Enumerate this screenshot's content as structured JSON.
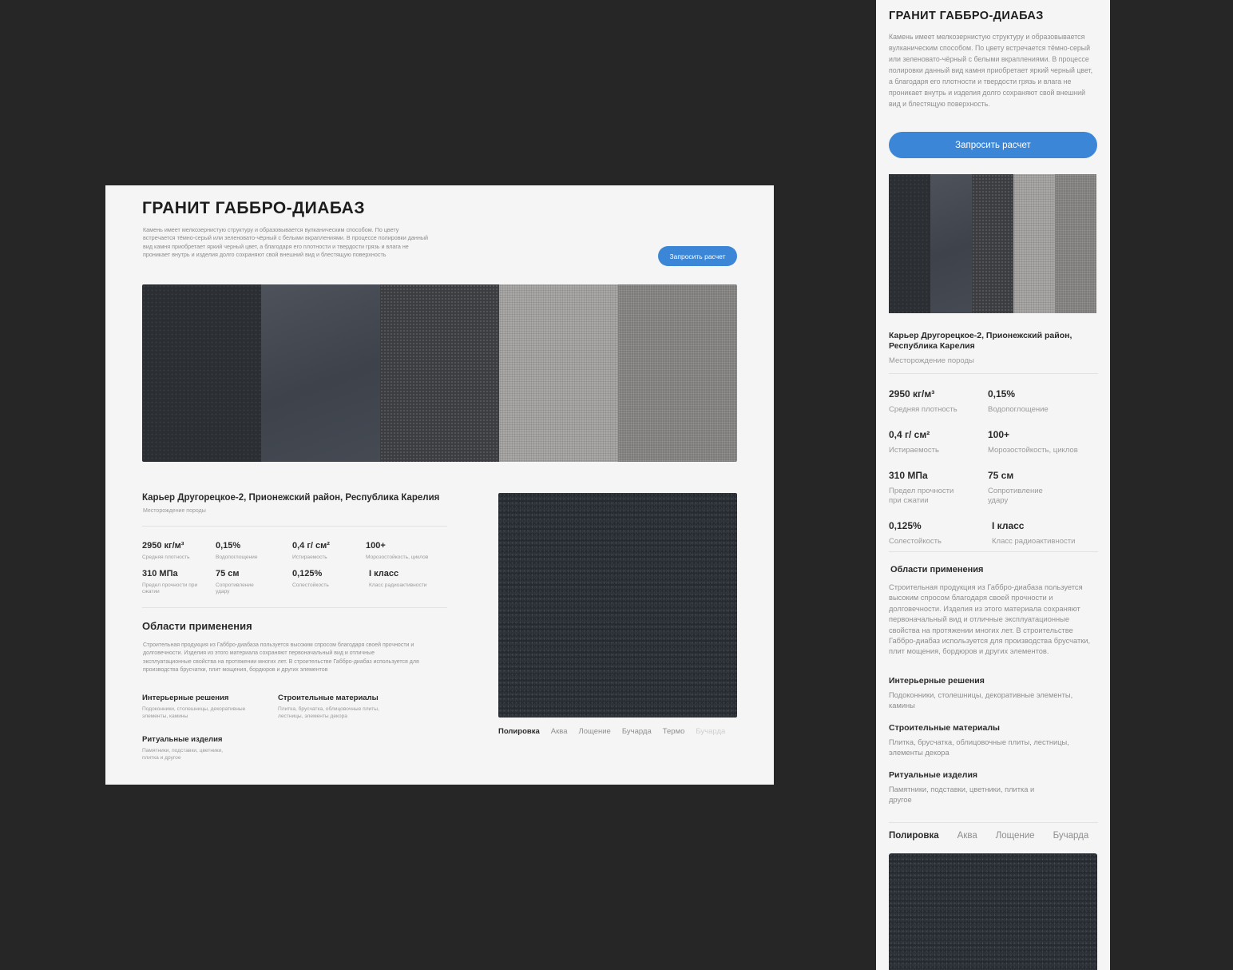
{
  "title": "ГРАНИТ ГАББРО-ДИАБАЗ",
  "desktop": {
    "description": "Камень имеет мелкозернистую структуру и образовывается вулканическим способом. По цвету встречается тёмно-серый или зеленовато-чёрный с белыми вкраплениями. В процессе полировки данный вид камня приобретает яркий черный цвет, а благодаря его плотности и твердости грязь и влага не проникает внутрь и изделия долго сохраняют свой внешний вид и блестящую поверхность",
    "area_text": "Строительная продукция из Габбро-диабаза пользуется высоким спросом благодаря своей прочности и долговечности. Изделия из этого материала сохраняют первоначальный вид и отличные эксплуатационные свойства на протяжении многих лет. В строительстве Габбро-диабаз используется для производства брусчатки, плит мощения, бордюров и других элементов",
    "quarry": "Карьер Другорецкое-2, Прионежский район, Республика Карелия",
    "stats": [
      {
        "value": "2950 кг/м³",
        "label": "Средняя плотность"
      },
      {
        "value": "0,15%",
        "label": "Водопоглощение"
      },
      {
        "value": "0,4 г/ см²",
        "label": "Истираемость"
      },
      {
        "value": "100+",
        "label": "Морозостойкость, циклов"
      },
      {
        "value": "310 МПа",
        "label": "Предел прочности при сжатии"
      },
      {
        "value": "75 см",
        "label": "Сопротивление удару"
      },
      {
        "value": "0,125%",
        "label": "Солестойкость"
      },
      {
        "value": "I класс",
        "label": "Класс радиоактивности"
      }
    ],
    "categories": [
      {
        "title": "Интерьерные решения",
        "text": "Подоконники, столешницы, декоративные элементы, камины"
      },
      {
        "title": "Строительные материалы",
        "text": "Плитка, брусчатка, облицовочные плиты, лестницы, элементы декора"
      },
      {
        "title": "Ритуальные изделия",
        "text": "Памятники, подставки, цветники, плитка и другое"
      }
    ],
    "tabs": [
      "Полировка",
      "Аква",
      "Лощение",
      "Бучарда",
      "Термо",
      "Бучарда"
    ]
  },
  "mobile": {
    "description": "Камень имеет мелкозернистую структуру и образовывается вулканическим способом. По цвету встречается тёмно-серый или зеленовато-чёрный с белыми вкраплениями. В процессе полировки данный вид камня приобретает яркий черный цвет, а благодаря его плотности и твердости грязь и влага не проникает внутрь и изделия долго сохраняют свой внешний вид и блестящую поверхность.",
    "area_text": "Строительная продукция из Габбро-диабаза пользуется высоким спросом благодаря своей прочности и долговечности. Изделия из этого материала сохраняют первоначальный вид и отличные эксплуатационные свойства на протяжении многих лет. В строительстве Габбро-диабаз используется для производства брусчатки, плит мощения, бордюров и других элементов.",
    "quarry": "Карьер Другорецкое-2, Прионежский район, Республика Карелия",
    "stats": [
      {
        "value": "2950 кг/м³",
        "label": "Средняя плотность"
      },
      {
        "value": "0,15%",
        "label": "Водопоглощение"
      },
      {
        "value": "0,4 г/ см²",
        "label": "Истираемость"
      },
      {
        "value": "100+",
        "label": "Морозостойкость, циклов"
      },
      {
        "value": "310 МПа",
        "label": "Предел прочности при сжатии"
      },
      {
        "value": "75 см",
        "label": "Сопротивление удару"
      },
      {
        "value": "0,125%",
        "label": "Солестойкость"
      },
      {
        "value": "I класс",
        "label": "Класс радиоактивности"
      }
    ],
    "categories": [
      {
        "title": "Интерьерные решения",
        "text": "Подоконники, столешницы, декоративные элементы, камины"
      },
      {
        "title": "Строительные материалы",
        "text": "Плитка, брусчатка, облицовочные плиты, лестницы, элементы декора"
      },
      {
        "title": "Ритуальные изделия",
        "text": "Памятники, подставки, цветники, плитка и другое"
      }
    ],
    "tabs": [
      "Полировка",
      "Аква",
      "Лощение",
      "Бучарда"
    ]
  },
  "cta_label": "Запросить расчет",
  "quarry_label": "Месторождение породы",
  "areas_title": "Области применения",
  "colors": {
    "background": "#262626",
    "card": "#f5f5f5",
    "accent": "#3b86d6"
  }
}
